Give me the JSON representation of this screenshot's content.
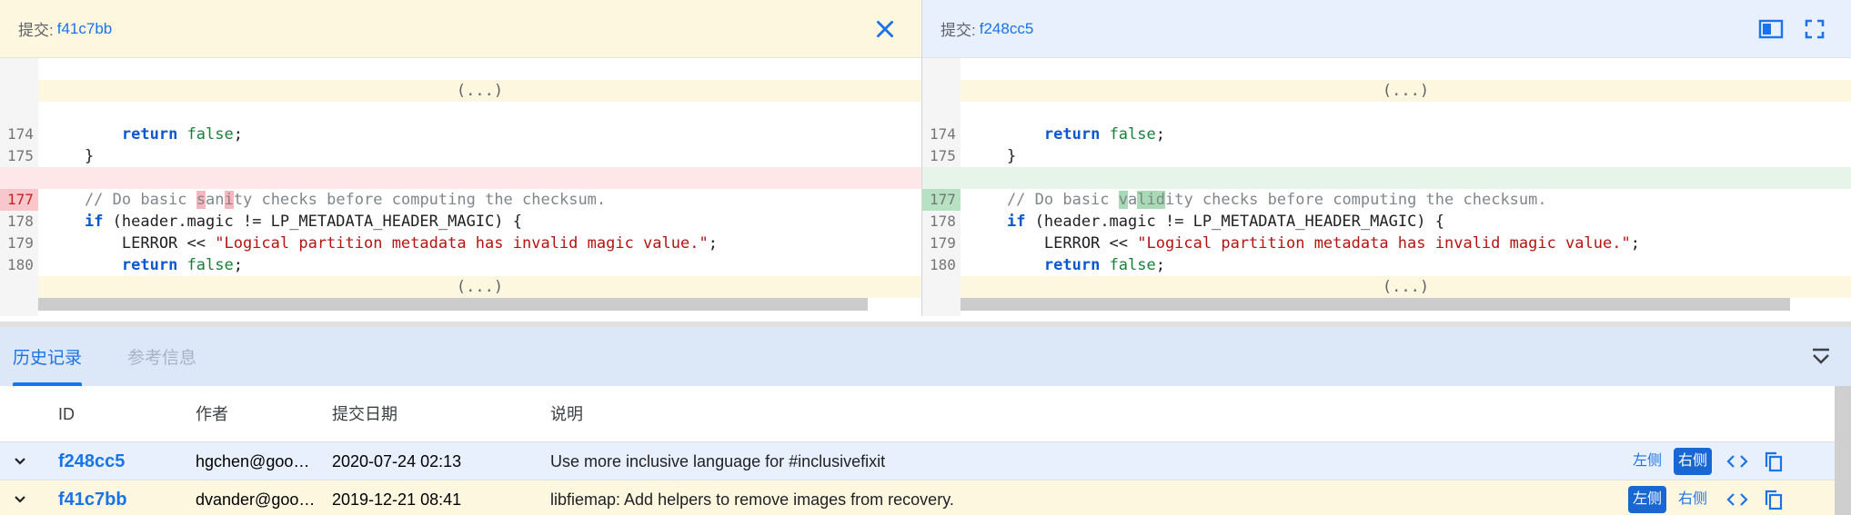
{
  "left_pane": {
    "label": "提交:",
    "hash": "f41c7bb",
    "lines": [
      {
        "kind": "skip",
        "num": "",
        "text": "(...)"
      },
      {
        "kind": "blank",
        "num": "",
        "text": ""
      },
      {
        "kind": "ctx",
        "num": "174",
        "text": "        return false;"
      },
      {
        "kind": "ctx",
        "num": "175",
        "text": "    }"
      },
      {
        "kind": "ctx",
        "num": "176",
        "text": ""
      },
      {
        "kind": "del",
        "num": "177",
        "text": "    // Do basic sanity checks before computing the checksum."
      },
      {
        "kind": "ctx",
        "num": "178",
        "text": "    if (header.magic != LP_METADATA_HEADER_MAGIC) {"
      },
      {
        "kind": "ctx",
        "num": "179",
        "text": "        LERROR << \"Logical partition metadata has invalid magic value.\";"
      },
      {
        "kind": "ctx",
        "num": "180",
        "text": "        return false;"
      },
      {
        "kind": "skip",
        "num": "",
        "text": "(...)"
      }
    ]
  },
  "right_pane": {
    "label": "提交:",
    "hash": "f248cc5",
    "lines": [
      {
        "kind": "skip",
        "num": "",
        "text": "(...)"
      },
      {
        "kind": "blank",
        "num": "",
        "text": ""
      },
      {
        "kind": "ctx",
        "num": "174",
        "text": "        return false;"
      },
      {
        "kind": "ctx",
        "num": "175",
        "text": "    }"
      },
      {
        "kind": "ctx",
        "num": "176",
        "text": ""
      },
      {
        "kind": "add",
        "num": "177",
        "text": "    // Do basic validity checks before computing the checksum."
      },
      {
        "kind": "ctx",
        "num": "178",
        "text": "    if (header.magic != LP_METADATA_HEADER_MAGIC) {"
      },
      {
        "kind": "ctx",
        "num": "179",
        "text": "        LERROR << \"Logical partition metadata has invalid magic value.\";"
      },
      {
        "kind": "ctx",
        "num": "180",
        "text": "        return false;"
      },
      {
        "kind": "skip",
        "num": "",
        "text": "(...)"
      }
    ]
  },
  "tabs": [
    {
      "label": "历史记录",
      "active": true
    },
    {
      "label": "参考信息",
      "active": false
    }
  ],
  "table": {
    "headers": {
      "id": "ID",
      "author": "作者",
      "date": "提交日期",
      "message": "说明"
    },
    "rows": [
      {
        "id": "f248cc5",
        "author": "hgchen@goo…",
        "date": "2020-07-24 02:13",
        "message": "Use more inclusive language for #inclusivefixit",
        "left_label": "左侧",
        "right_label": "右侧",
        "selected": "right"
      },
      {
        "id": "f41c7bb",
        "author": "dvander@goo…",
        "date": "2019-12-21 08:41",
        "message": "libfiemap: Add helpers to remove images from recovery.",
        "left_label": "左侧",
        "right_label": "右侧",
        "selected": "left"
      }
    ]
  },
  "colors": {
    "accent": "#1a73e8",
    "left_header_bg": "#fef7e0",
    "right_header_bg": "#e8f0fe",
    "deleted_line": "#fde7e9",
    "added_line": "#e6f4ea"
  }
}
